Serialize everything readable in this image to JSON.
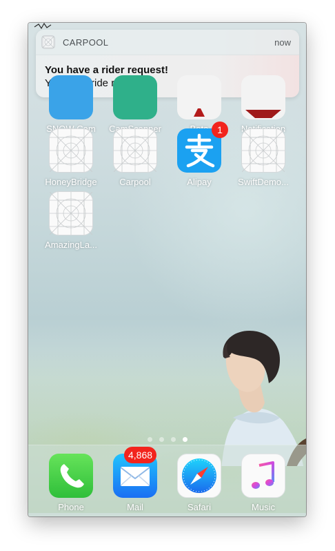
{
  "notification": {
    "app_name": "CARPOOL",
    "time": "now",
    "title": "You have a rider request!",
    "message": "You got a ride request!"
  },
  "home_apps": [
    {
      "label": "SNOW Cam"
    },
    {
      "label": "CamScanner"
    },
    {
      "label": "Beta"
    },
    {
      "label": "Notification"
    },
    {
      "label": "HoneyBridge"
    },
    {
      "label": "Carpool"
    },
    {
      "label": "Alipay",
      "badge": "1"
    },
    {
      "label": "SwiftDemo..."
    },
    {
      "label": "AmazingLa..."
    }
  ],
  "page_indicator": {
    "count": 4,
    "current": 4
  },
  "dock_apps": [
    {
      "label": "Phone"
    },
    {
      "label": "Mail",
      "badge": "4,868"
    },
    {
      "label": "Safari"
    },
    {
      "label": "Music"
    }
  ],
  "colors": {
    "alipay_blue": "#1ba1f1",
    "phone_green": "#4cd964",
    "mail_blue": "#2a8cf5",
    "badge_red": "#f2241d"
  }
}
